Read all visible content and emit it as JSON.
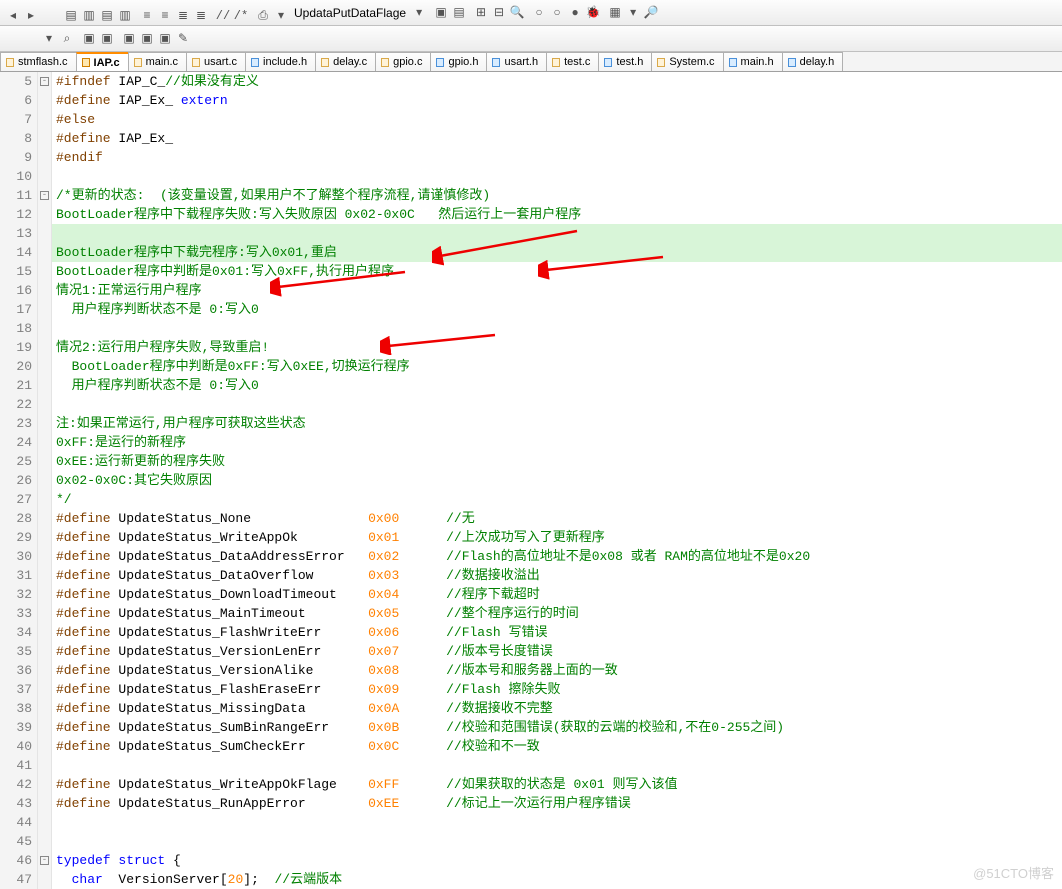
{
  "toolbar": {
    "dropdown_label": "UpdataPutDataFlage"
  },
  "tabs": [
    {
      "label": "stmflash.c",
      "cls": "cfile"
    },
    {
      "label": "IAP.c",
      "cls": "cfile active"
    },
    {
      "label": "main.c",
      "cls": "cfile"
    },
    {
      "label": "usart.c",
      "cls": "cfile"
    },
    {
      "label": "include.h",
      "cls": "hfile"
    },
    {
      "label": "delay.c",
      "cls": "cfile"
    },
    {
      "label": "gpio.c",
      "cls": "cfile"
    },
    {
      "label": "gpio.h",
      "cls": "hfile"
    },
    {
      "label": "usart.h",
      "cls": "hfile"
    },
    {
      "label": "test.c",
      "cls": "cfile"
    },
    {
      "label": "test.h",
      "cls": "hfile"
    },
    {
      "label": "System.c",
      "cls": "cfile"
    },
    {
      "label": "main.h",
      "cls": "hfile"
    },
    {
      "label": "delay.h",
      "cls": "hfile"
    }
  ],
  "lines": [
    {
      "n": 5,
      "fold": "-",
      "html": "<span class='pp'>#ifndef</span> IAP_C_<span class='cm'>//如果没有定义</span>"
    },
    {
      "n": 6,
      "html": "<span class='pp'>#define</span> IAP_Ex_ <span class='kw'>extern</span>"
    },
    {
      "n": 7,
      "html": "<span class='pp'>#else</span>"
    },
    {
      "n": 8,
      "html": "<span class='pp'>#define</span> IAP_Ex_"
    },
    {
      "n": 9,
      "html": "<span class='pp'>#endif</span>"
    },
    {
      "n": 10,
      "html": ""
    },
    {
      "n": 11,
      "fold": "-",
      "html": "<span class='cm'>/*更新的状态:  (该变量设置,如果用户不了解整个程序流程,请谨慎修改)</span>"
    },
    {
      "n": 12,
      "html": "<span class='cm'>BootLoader程序中下载程序失败:写入失败原因 0x02-0x0C   然后运行上一套用户程序</span>"
    },
    {
      "n": 13,
      "hl": true,
      "html": "<span class='cm'></span>"
    },
    {
      "n": 14,
      "hl": true,
      "html": "<span class='cm'>BootLoader程序中下载完程序:写入0x01,重启</span>"
    },
    {
      "n": 15,
      "html": "<span class='cm'>BootLoader程序中判断是0x01:写入0xFF,执行用户程序</span>"
    },
    {
      "n": 16,
      "html": "<span class='cm'>情况1:正常运行用户程序</span>"
    },
    {
      "n": 17,
      "html": "<span class='cm'>  用户程序判断状态不是 0:写入0</span>"
    },
    {
      "n": 18,
      "html": ""
    },
    {
      "n": 19,
      "html": "<span class='cm'>情况2:运行用户程序失败,导致重启!</span>"
    },
    {
      "n": 20,
      "html": "<span class='cm'>  BootLoader程序中判断是0xFF:写入0xEE,切换运行程序</span>"
    },
    {
      "n": 21,
      "html": "<span class='cm'>  用户程序判断状态不是 0:写入0</span>"
    },
    {
      "n": 22,
      "html": ""
    },
    {
      "n": 23,
      "html": "<span class='cm'>注:如果正常运行,用户程序可获取这些状态</span>"
    },
    {
      "n": 24,
      "html": "<span class='cm'>0xFF:是运行的新程序</span>"
    },
    {
      "n": 25,
      "html": "<span class='cm'>0xEE:运行新更新的程序失败</span>"
    },
    {
      "n": 26,
      "html": "<span class='cm'>0x02-0x0C:其它失败原因</span>"
    },
    {
      "n": 27,
      "html": "<span class='cm'>*/</span>"
    },
    {
      "n": 28,
      "html": "<span class='pp'>#define</span> UpdateStatus_None               <span class='num'>0x00</span>      <span class='cm'>//无</span>"
    },
    {
      "n": 29,
      "html": "<span class='pp'>#define</span> UpdateStatus_WriteAppOk         <span class='num'>0x01</span>      <span class='cm'>//上次成功写入了更新程序</span>"
    },
    {
      "n": 30,
      "html": "<span class='pp'>#define</span> UpdateStatus_DataAddressError   <span class='num'>0x02</span>      <span class='cm'>//Flash的高位地址不是0x08 或者 RAM的高位地址不是0x20</span>"
    },
    {
      "n": 31,
      "html": "<span class='pp'>#define</span> UpdateStatus_DataOverflow       <span class='num'>0x03</span>      <span class='cm'>//数据接收溢出</span>"
    },
    {
      "n": 32,
      "html": "<span class='pp'>#define</span> UpdateStatus_DownloadTimeout    <span class='num'>0x04</span>      <span class='cm'>//程序下载超时</span>"
    },
    {
      "n": 33,
      "html": "<span class='pp'>#define</span> UpdateStatus_MainTimeout        <span class='num'>0x05</span>      <span class='cm'>//整个程序运行的时间</span>"
    },
    {
      "n": 34,
      "html": "<span class='pp'>#define</span> UpdateStatus_FlashWriteErr      <span class='num'>0x06</span>      <span class='cm'>//Flash 写错误</span>"
    },
    {
      "n": 35,
      "html": "<span class='pp'>#define</span> UpdateStatus_VersionLenErr      <span class='num'>0x07</span>      <span class='cm'>//版本号长度错误</span>"
    },
    {
      "n": 36,
      "html": "<span class='pp'>#define</span> UpdateStatus_VersionAlike       <span class='num'>0x08</span>      <span class='cm'>//版本号和服务器上面的一致</span>"
    },
    {
      "n": 37,
      "html": "<span class='pp'>#define</span> UpdateStatus_FlashEraseErr      <span class='num'>0x09</span>      <span class='cm'>//Flash 擦除失败</span>"
    },
    {
      "n": 38,
      "html": "<span class='pp'>#define</span> UpdateStatus_MissingData        <span class='num'>0x0A</span>      <span class='cm'>//数据接收不完整</span>"
    },
    {
      "n": 39,
      "html": "<span class='pp'>#define</span> UpdateStatus_SumBinRangeErr     <span class='num'>0x0B</span>      <span class='cm'>//校验和范围错误(获取的云端的校验和,不在0-255之间)</span>"
    },
    {
      "n": 40,
      "html": "<span class='pp'>#define</span> UpdateStatus_SumCheckErr        <span class='num'>0x0C</span>      <span class='cm'>//校验和不一致</span>"
    },
    {
      "n": 41,
      "html": ""
    },
    {
      "n": 42,
      "html": "<span class='pp'>#define</span> UpdateStatus_WriteAppOkFlage    <span class='num'>0xFF</span>      <span class='cm'>//如果获取的状态是 0x01 则写入该值</span>"
    },
    {
      "n": 43,
      "html": "<span class='pp'>#define</span> UpdateStatus_RunAppError        <span class='num'>0xEE</span>      <span class='cm'>//标记上一次运行用户程序错误</span>"
    },
    {
      "n": 44,
      "html": ""
    },
    {
      "n": 45,
      "html": ""
    },
    {
      "n": 46,
      "fold": "-",
      "html": "<span class='kw'>typedef</span> <span class='kw'>struct</span> {"
    },
    {
      "n": 47,
      "html": "  <span class='kw'>char</span>  VersionServer[<span class='num'>20</span>];  <span class='cm'>//云端版本</span>"
    }
  ],
  "toolbar_icons1": [
    "◂",
    "▸",
    "",
    "│",
    "▤",
    "▥",
    "▤",
    "▥",
    "│",
    "≡",
    "≡",
    "≣",
    "≣",
    "│",
    "//",
    "/*",
    "│",
    "⎙",
    "▾"
  ],
  "toolbar_icons1b": [
    "▾",
    "│",
    "▣",
    "▤",
    "│",
    "⊞",
    "⊟",
    "🔍",
    "│",
    "○",
    "○",
    "●",
    "🐞",
    "│",
    "▦",
    "▾",
    "🔎"
  ],
  "toolbar_icons2": [
    "▾",
    "⌕",
    "│",
    "▣",
    "▣",
    "│",
    "▣",
    "▣",
    "▣",
    "✎"
  ],
  "watermark": "@51CTO博客"
}
